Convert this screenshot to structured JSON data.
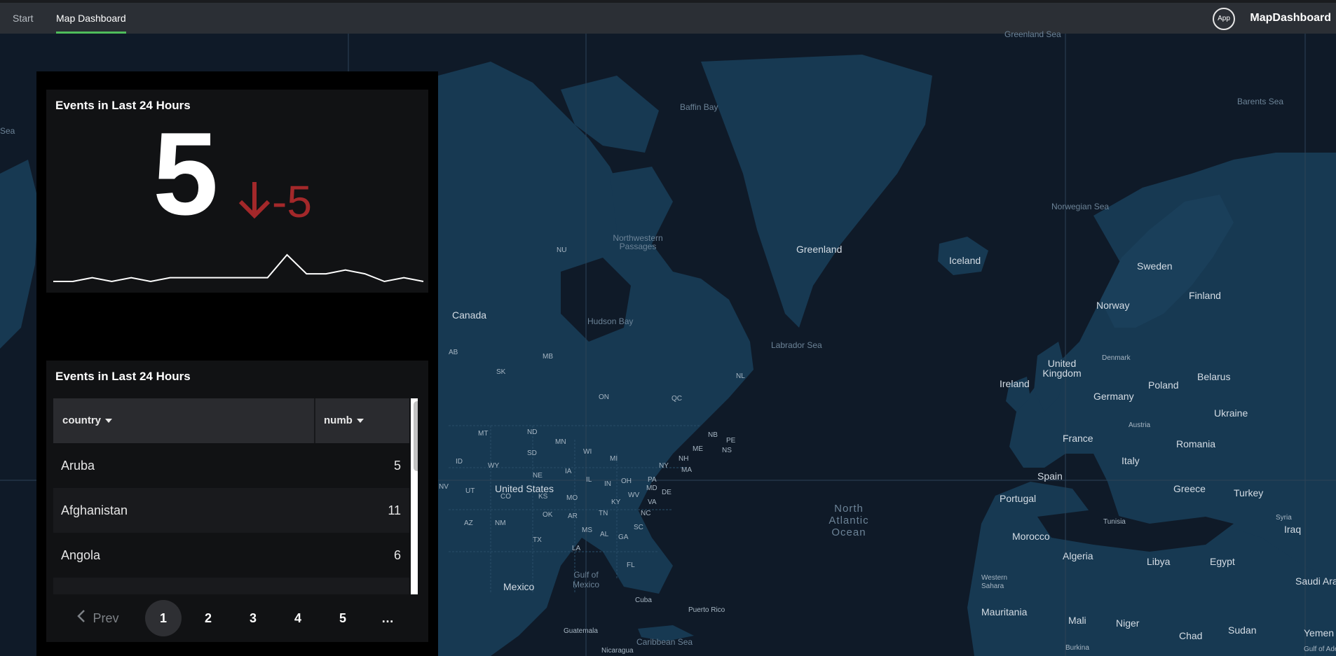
{
  "nav": {
    "tabs": [
      {
        "label": "Start"
      },
      {
        "label": "Map Dashboard"
      }
    ],
    "app_badge": "App",
    "app_name": "MapDashboard"
  },
  "colors": {
    "accent_tab": "#4fbd5b",
    "trend_down": "#a3282a",
    "map_water": "#0f1a28",
    "map_land": "#173952"
  },
  "map": {
    "labels": [
      {
        "text": "Greenland Sea",
        "kind": "sea"
      },
      {
        "text": "Barents Sea",
        "kind": "sea"
      },
      {
        "text": "Baffin Bay",
        "kind": "sea"
      },
      {
        "text": "Sea",
        "kind": "sea"
      },
      {
        "text": "Norwegian Sea",
        "kind": "sea"
      },
      {
        "text": "Hudson Bay",
        "kind": "sea"
      },
      {
        "text": "Labrador Sea",
        "kind": "sea"
      },
      {
        "text": "Gulf of Mexico",
        "kind": "sea"
      },
      {
        "text": "Caribbean Sea",
        "kind": "sea"
      },
      {
        "text": "Greenland",
        "kind": "big"
      },
      {
        "text": "Iceland",
        "kind": "big"
      },
      {
        "text": "Canada",
        "kind": "big"
      },
      {
        "text": "Sweden",
        "kind": "big"
      },
      {
        "text": "Finland",
        "kind": "big"
      },
      {
        "text": "Norway",
        "kind": "big"
      },
      {
        "text": "United Kingdom",
        "kind": "big"
      },
      {
        "text": "Ireland",
        "kind": "big"
      },
      {
        "text": "Denmark",
        "kind": "small"
      },
      {
        "text": "Belarus",
        "kind": "big"
      },
      {
        "text": "Poland",
        "kind": "big"
      },
      {
        "text": "Germany",
        "kind": "big"
      },
      {
        "text": "Ukraine",
        "kind": "big"
      },
      {
        "text": "Austria",
        "kind": "small"
      },
      {
        "text": "France",
        "kind": "big"
      },
      {
        "text": "Romania",
        "kind": "big"
      },
      {
        "text": "Italy",
        "kind": "big"
      },
      {
        "text": "Spain",
        "kind": "big"
      },
      {
        "text": "Portugal",
        "kind": "big"
      },
      {
        "text": "Greece",
        "kind": "big"
      },
      {
        "text": "Turkey",
        "kind": "big"
      },
      {
        "text": "Syria",
        "kind": "small"
      },
      {
        "text": "Iraq",
        "kind": "big"
      },
      {
        "text": "Tunisia",
        "kind": "small"
      },
      {
        "text": "Morocco",
        "kind": "big"
      },
      {
        "text": "Algeria",
        "kind": "big"
      },
      {
        "text": "Libya",
        "kind": "big"
      },
      {
        "text": "Egypt",
        "kind": "big"
      },
      {
        "text": "Saudi Arabia",
        "kind": "big"
      },
      {
        "text": "Western Sahara",
        "kind": "small"
      },
      {
        "text": "Mauritania",
        "kind": "big"
      },
      {
        "text": "Mali",
        "kind": "big"
      },
      {
        "text": "Niger",
        "kind": "big"
      },
      {
        "text": "Chad",
        "kind": "big"
      },
      {
        "text": "Sudan",
        "kind": "big"
      },
      {
        "text": "Yemen",
        "kind": "big"
      },
      {
        "text": "Burkina",
        "kind": "small"
      },
      {
        "text": "Gulf of Aden",
        "kind": "small"
      },
      {
        "text": "United States",
        "kind": "big"
      },
      {
        "text": "Mexico",
        "kind": "big"
      },
      {
        "text": "Cuba",
        "kind": "small"
      },
      {
        "text": "Puerto Rico",
        "kind": "small"
      },
      {
        "text": "Guatemala",
        "kind": "small"
      },
      {
        "text": "Nicaragua",
        "kind": "small"
      },
      {
        "text": "Northwestern Passages",
        "kind": "sea"
      },
      {
        "text": "NU",
        "kind": "small"
      },
      {
        "text": "AB",
        "kind": "small"
      },
      {
        "text": "MB",
        "kind": "small"
      },
      {
        "text": "SK",
        "kind": "small"
      },
      {
        "text": "ON",
        "kind": "small"
      },
      {
        "text": "QC",
        "kind": "small"
      },
      {
        "text": "NL",
        "kind": "small"
      },
      {
        "text": "NB",
        "kind": "small"
      },
      {
        "text": "PE",
        "kind": "small"
      },
      {
        "text": "NS",
        "kind": "small"
      },
      {
        "text": "MT",
        "kind": "small"
      },
      {
        "text": "ND",
        "kind": "small"
      },
      {
        "text": "MN",
        "kind": "small"
      },
      {
        "text": "SD",
        "kind": "small"
      },
      {
        "text": "WI",
        "kind": "small"
      },
      {
        "text": "MI",
        "kind": "small"
      },
      {
        "text": "NY",
        "kind": "small"
      },
      {
        "text": "NH",
        "kind": "small"
      },
      {
        "text": "ME",
        "kind": "small"
      },
      {
        "text": "MA",
        "kind": "small"
      },
      {
        "text": "ID",
        "kind": "small"
      },
      {
        "text": "WY",
        "kind": "small"
      },
      {
        "text": "NE",
        "kind": "small"
      },
      {
        "text": "IA",
        "kind": "small"
      },
      {
        "text": "IL",
        "kind": "small"
      },
      {
        "text": "IN",
        "kind": "small"
      },
      {
        "text": "OH",
        "kind": "small"
      },
      {
        "text": "PA",
        "kind": "small"
      },
      {
        "text": "MD",
        "kind": "small"
      },
      {
        "text": "DE",
        "kind": "small"
      },
      {
        "text": "NV",
        "kind": "small"
      },
      {
        "text": "UT",
        "kind": "small"
      },
      {
        "text": "CO",
        "kind": "small"
      },
      {
        "text": "KS",
        "kind": "small"
      },
      {
        "text": "MO",
        "kind": "small"
      },
      {
        "text": "KY",
        "kind": "small"
      },
      {
        "text": "WV",
        "kind": "small"
      },
      {
        "text": "VA",
        "kind": "small"
      },
      {
        "text": "AZ",
        "kind": "small"
      },
      {
        "text": "NM",
        "kind": "small"
      },
      {
        "text": "OK",
        "kind": "small"
      },
      {
        "text": "AR",
        "kind": "small"
      },
      {
        "text": "TN",
        "kind": "small"
      },
      {
        "text": "NC",
        "kind": "small"
      },
      {
        "text": "TX",
        "kind": "small"
      },
      {
        "text": "MS",
        "kind": "small"
      },
      {
        "text": "AL",
        "kind": "small"
      },
      {
        "text": "GA",
        "kind": "small"
      },
      {
        "text": "SC",
        "kind": "small"
      },
      {
        "text": "LA",
        "kind": "small"
      },
      {
        "text": "FL",
        "kind": "small"
      },
      {
        "text": "North Atlantic Ocean",
        "kind": "ocean"
      }
    ]
  },
  "single_value": {
    "title": "Events in Last 24 Hours",
    "value": "5",
    "delta": "-5",
    "trend": "down",
    "sparkline": [
      1,
      1,
      2,
      1,
      2,
      1,
      2,
      2,
      2,
      2,
      2,
      2,
      8,
      3,
      3,
      4,
      3,
      1,
      2,
      1
    ]
  },
  "table": {
    "title": "Events in Last 24 Hours",
    "columns": [
      "country",
      "numb"
    ],
    "rows": [
      {
        "country": "Aruba",
        "numb": "5"
      },
      {
        "country": "Afghanistan",
        "numb": "11"
      },
      {
        "country": "Angola",
        "numb": "6"
      }
    ],
    "pagination": {
      "prev_label": "Prev",
      "pages": [
        "1",
        "2",
        "3",
        "4",
        "5"
      ],
      "current": "1",
      "ellipsis": "…"
    }
  }
}
